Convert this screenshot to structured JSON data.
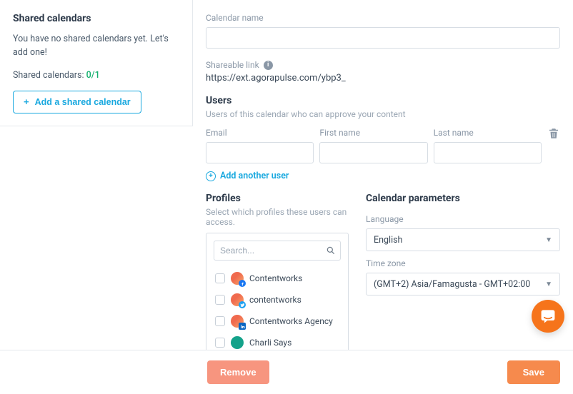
{
  "sidebar": {
    "title": "Shared calendars",
    "empty_text": "You have no shared calendars yet. Let's add one!",
    "count_label": "Shared calendars:",
    "count_value": "0/1",
    "add_button": "Add a shared calendar"
  },
  "form": {
    "calendar_name_label": "Calendar name",
    "calendar_name_value": "",
    "shareable_label": "Shareable link",
    "shareable_value": "https://ext.agorapulse.com/ybp3_",
    "users_title": "Users",
    "users_sub": "Users of this calendar who can approve your content",
    "email_label": "Email",
    "first_name_label": "First name",
    "last_name_label": "Last name",
    "add_user": "Add another user",
    "profiles_title": "Profiles",
    "profiles_sub": "Select which profiles these users can access.",
    "search_placeholder": "Search...",
    "profiles": [
      {
        "name": "Contentworks",
        "badge": "fb",
        "variant": "default"
      },
      {
        "name": "contentworks",
        "badge": "tw",
        "variant": "default"
      },
      {
        "name": "Contentworks Agency",
        "badge": "li",
        "variant": "default"
      },
      {
        "name": "Charli Says",
        "badge": "",
        "variant": "teal"
      }
    ],
    "params_title": "Calendar parameters",
    "language_label": "Language",
    "language_value": "English",
    "tz_label": "Time zone",
    "tz_value": "(GMT+2) Asia/Famagusta - GMT+02:00"
  },
  "footer": {
    "remove": "Remove",
    "save": "Save"
  }
}
